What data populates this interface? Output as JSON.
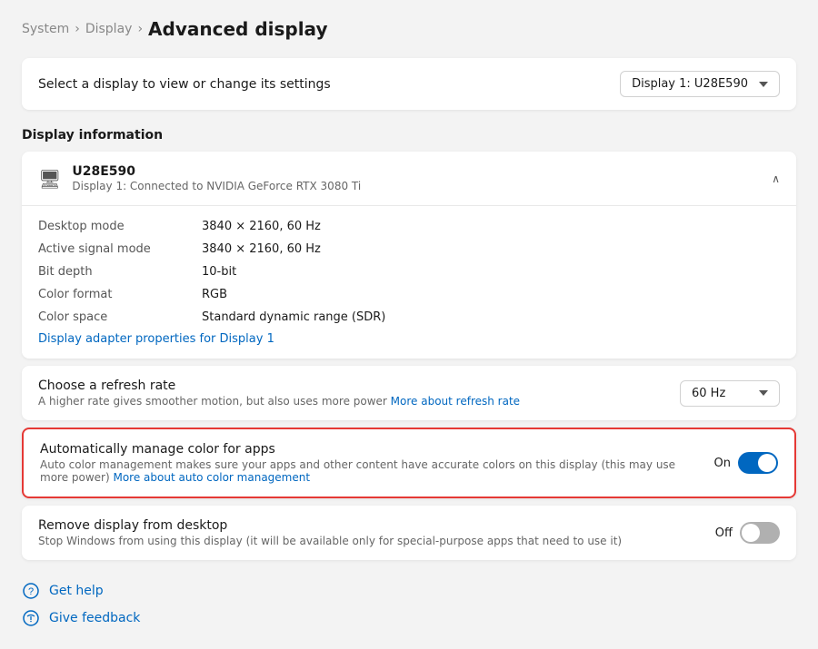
{
  "breadcrumb": {
    "parent1": "System",
    "parent2": "Display",
    "current": "Advanced display",
    "sep": "›"
  },
  "selector": {
    "label": "Select a display to view or change its settings",
    "dropdown_value": "Display 1: U28E590",
    "dropdown_chevron": "▾"
  },
  "display_info": {
    "section_title": "Display information",
    "monitor_icon": "🖥",
    "display_name": "U28E590",
    "display_subtitle": "Display 1: Connected to NVIDIA GeForce RTX 3080 Ti",
    "chevron_up": "∧",
    "rows": [
      {
        "label": "Desktop mode",
        "value": "3840 × 2160, 60 Hz"
      },
      {
        "label": "Active signal mode",
        "value": "3840 × 2160, 60 Hz"
      },
      {
        "label": "Bit depth",
        "value": "10-bit"
      },
      {
        "label": "Color format",
        "value": "RGB"
      },
      {
        "label": "Color space",
        "value": "Standard dynamic range (SDR)"
      }
    ],
    "adapter_link": "Display adapter properties for Display 1"
  },
  "refresh_rate": {
    "title": "Choose a refresh rate",
    "desc": "A higher rate gives smoother motion, but also uses more power",
    "desc_link": "More about refresh rate",
    "dropdown_value": "60 Hz",
    "dropdown_chevron": "▾"
  },
  "auto_color": {
    "title": "Automatically manage color for apps",
    "desc": "Auto color management makes sure your apps and other content have accurate colors on this display (this may use more power)",
    "desc_link": "More about auto color management",
    "toggle_state": "on",
    "toggle_label": "On"
  },
  "remove_display": {
    "title": "Remove display from desktop",
    "desc": "Stop Windows from using this display (it will be available only for special-purpose apps that need to use it)",
    "toggle_state": "off",
    "toggle_label": "Off"
  },
  "footer": {
    "get_help_label": "Get help",
    "give_feedback_label": "Give feedback"
  }
}
